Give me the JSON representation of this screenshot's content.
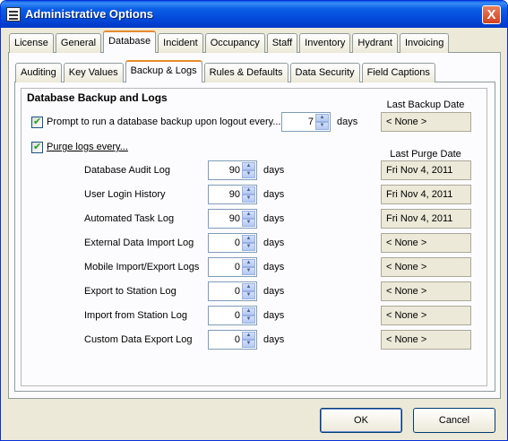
{
  "window": {
    "title": "Administrative Options",
    "close_label": "X"
  },
  "main_tabs": [
    "License",
    "General",
    "Database",
    "Incident",
    "Occupancy",
    "Staff",
    "Inventory",
    "Hydrant",
    "Invoicing"
  ],
  "sub_tabs": [
    "Auditing",
    "Key Values",
    "Backup & Logs",
    "Rules & Defaults",
    "Data Security",
    "Field Captions"
  ],
  "group": {
    "title": "Database Backup and Logs"
  },
  "backup": {
    "prompt_label": "Prompt to run a database backup upon logout every...",
    "prompt_checked": true,
    "value": "7",
    "units": "days",
    "last_backup_header": "Last Backup Date",
    "last_backup_value": "< None >"
  },
  "purge": {
    "label": "Purge logs every...",
    "checked": true,
    "last_purge_header": "Last Purge Date",
    "units": "days",
    "logs": [
      {
        "name": "Database Audit Log",
        "value": "90",
        "last": "Fri Nov 4, 2011"
      },
      {
        "name": "User Login History",
        "value": "90",
        "last": "Fri Nov 4, 2011"
      },
      {
        "name": "Automated Task Log",
        "value": "90",
        "last": "Fri Nov 4, 2011"
      },
      {
        "name": "External Data Import Log",
        "value": "0",
        "last": "< None >"
      },
      {
        "name": "Mobile Import/Export Logs",
        "value": "0",
        "last": "< None >"
      },
      {
        "name": "Export to Station Log",
        "value": "0",
        "last": "< None >"
      },
      {
        "name": "Import from Station Log",
        "value": "0",
        "last": "< None >"
      },
      {
        "name": "Custom Data Export Log",
        "value": "0",
        "last": "< None >"
      }
    ]
  },
  "buttons": {
    "ok": "OK",
    "cancel": "Cancel"
  }
}
